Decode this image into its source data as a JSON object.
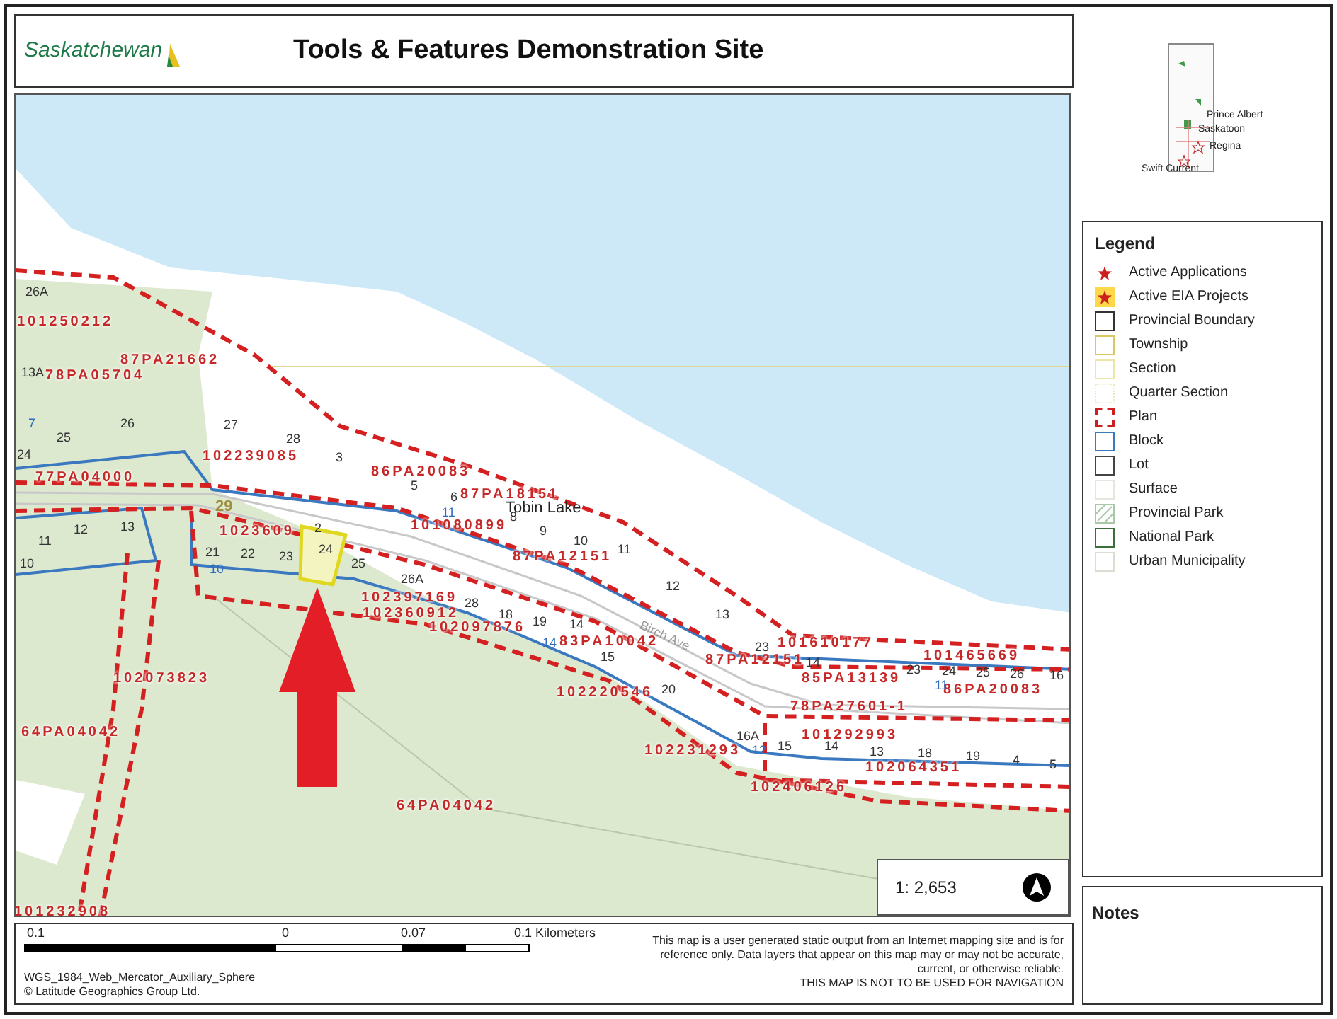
{
  "header": {
    "logo": "Saskatchewan",
    "title": "Tools & Features Demonstration Site"
  },
  "overview": {
    "places": [
      "Prince Albert",
      "Saskatoon",
      "Regina",
      "Swift Current"
    ]
  },
  "map": {
    "plan_labels": [
      "101250212",
      "87PA21662",
      "78PA05704",
      "102239085",
      "77PA04000",
      "86PA20083",
      "87PA18151",
      "101080899",
      "87PA12151",
      "1023609",
      "102397169",
      "102360912",
      "102097876",
      "83PA10042",
      "102073823",
      "102220546",
      "87PA12151",
      "101610177",
      "85PA13139",
      "101465669",
      "86PA20083",
      "78PA27601-1",
      "64PA04042",
      "102231293",
      "101292993",
      "102064351",
      "102406126",
      "64PA04042",
      "101232908"
    ],
    "lot_labels": [
      "26A",
      "13A",
      "25",
      "26",
      "24",
      "27",
      "28",
      "3",
      "5",
      "6",
      "8",
      "9",
      "10",
      "11",
      "12",
      "13",
      "23",
      "14",
      "11",
      "12",
      "13",
      "10",
      "21",
      "22",
      "23",
      "24",
      "25",
      "26A",
      "28",
      "18",
      "19",
      "14",
      "15",
      "20",
      "16A",
      "15",
      "14",
      "13",
      "18",
      "19",
      "4",
      "5",
      "23",
      "24",
      "25",
      "26",
      "16",
      "2"
    ],
    "block_labels": [
      "7",
      "10",
      "11",
      "11",
      "12",
      "14"
    ],
    "township_labels": [
      "29"
    ],
    "place_labels": [
      "Tobin Lake"
    ],
    "street_labels": [
      "Birch Ave"
    ],
    "scale": "1: 2,653"
  },
  "legend": {
    "title": "Legend",
    "items": [
      {
        "label": "Active Applications",
        "kind": "star",
        "color": "#cc1f1f"
      },
      {
        "label": "Active EIA Projects",
        "kind": "star-highlight",
        "color": "#cc1f1f"
      },
      {
        "label": "Provincial Boundary",
        "kind": "box",
        "color": "#333333"
      },
      {
        "label": "Township",
        "kind": "box",
        "color": "#d8c860"
      },
      {
        "label": "Section",
        "kind": "box",
        "color": "#ece6a8"
      },
      {
        "label": "Quarter Section",
        "kind": "dotted",
        "color": "#eeeac8"
      },
      {
        "label": "Plan",
        "kind": "dashed",
        "color": "#cc1f1f"
      },
      {
        "label": "Block",
        "kind": "box",
        "color": "#3a78c0"
      },
      {
        "label": "Lot",
        "kind": "box",
        "color": "#444444"
      },
      {
        "label": "Surface",
        "kind": "box",
        "color": "#e6e6dc"
      },
      {
        "label": "Provincial Park",
        "kind": "hatch",
        "color": "#a8c8a8"
      },
      {
        "label": "National Park",
        "kind": "box",
        "color": "#3c6e3c"
      },
      {
        "label": "Urban Municipality",
        "kind": "box",
        "color": "#dcdcd0"
      }
    ]
  },
  "notes": {
    "title": "Notes"
  },
  "footer": {
    "scale_ticks": [
      "0.1",
      "0",
      "0.07",
      "0.1 Kilometers"
    ],
    "projection": "WGS_1984_Web_Mercator_Auxiliary_Sphere",
    "copyright": "© Latitude Geographics Group Ltd.",
    "disclaimer": "This map is a user generated static output from an Internet mapping site and is for reference only. Data layers that appear on this map may or may not be accurate, current, or otherwise reliable.",
    "warning": "THIS MAP IS NOT TO BE USED FOR NAVIGATION"
  }
}
